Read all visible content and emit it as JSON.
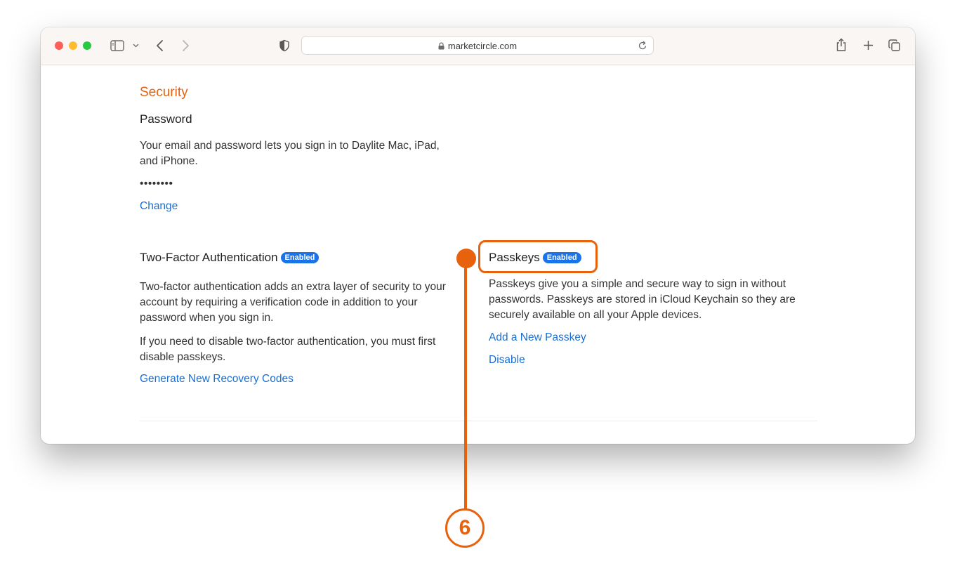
{
  "browser": {
    "url": "marketcircle.com",
    "colors": {
      "close": "#fe5f57",
      "minimize": "#febc2e",
      "zoom": "#28c840"
    },
    "icons": [
      "sidebar-icon",
      "chevron-down-icon",
      "back-icon",
      "forward-icon",
      "shield-icon",
      "lock-icon",
      "reload-icon",
      "share-icon",
      "plus-icon",
      "tabs-overview-icon"
    ]
  },
  "page": {
    "section_title": "Security",
    "password": {
      "heading": "Password",
      "description_line1": "Your email and password lets you sign in to Daylite Mac, iPad,",
      "description_line2": "and iPhone.",
      "masked_value": "••••••••",
      "change_link": "Change"
    },
    "two_factor": {
      "heading": "Two-Factor Authentication",
      "badge": "Enabled",
      "description_line1": "Two-factor authentication adds an extra layer of security to your",
      "description_line2": "account by requiring a verification code in addition to your",
      "description_line3": "password when you sign in.",
      "note_line1": "If you need to disable two-factor authentication, you must first",
      "note_line2": "disable passkeys.",
      "recovery_link": "Generate New Recovery Codes"
    },
    "passkeys": {
      "heading": "Passkeys",
      "badge": "Enabled",
      "description_line1": "Passkeys give you a simple and secure way to sign in without",
      "description_line2": "passwords. Passkeys are stored in iCloud Keychain so they are",
      "description_line3": "securely available on all your Apple devices.",
      "add_link": "Add a New Passkey",
      "disable_link": "Disable"
    }
  },
  "annotation": {
    "number": "6",
    "color": "#e8620e"
  }
}
